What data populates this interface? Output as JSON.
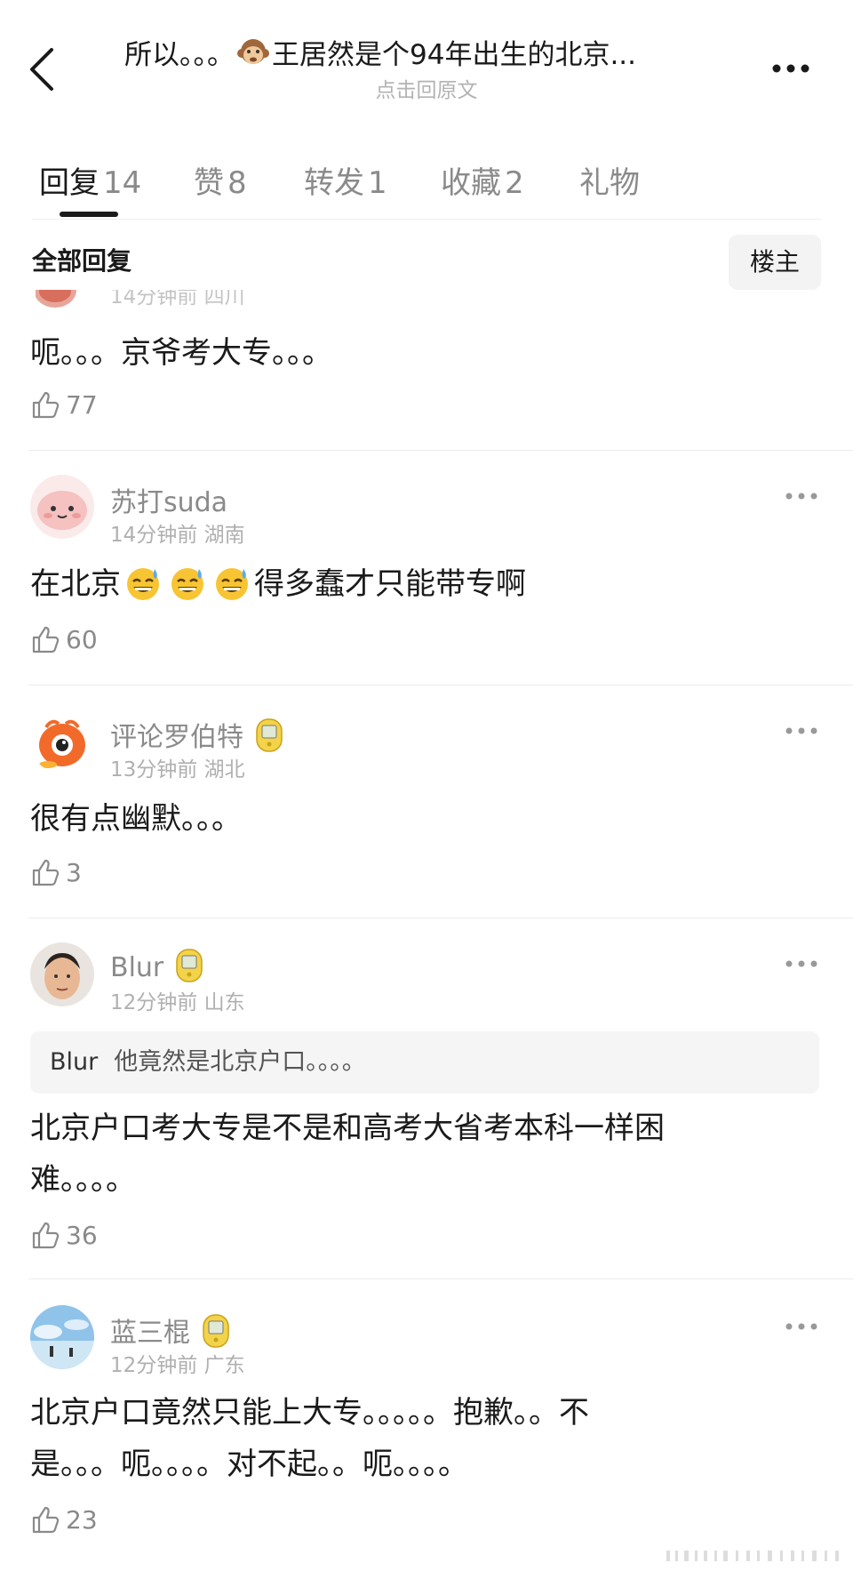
{
  "header": {
    "title_prefix": "所以。。。",
    "title_suffix": "王居然是个94年出生的北京...",
    "subtitle": "点击回原文"
  },
  "tabs": [
    {
      "label": "回复",
      "count": "14",
      "active": true
    },
    {
      "label": "赞",
      "count": "8",
      "active": false
    },
    {
      "label": "转发",
      "count": "1",
      "active": false
    },
    {
      "label": "收藏",
      "count": "2",
      "active": false
    },
    {
      "label": "礼物",
      "count": "",
      "active": false
    }
  ],
  "section": {
    "title": "全部回复",
    "owner_button": "楼主"
  },
  "partial_comment": {
    "meta": "14分钟前 四川",
    "content": "呃。。。京爷考大专。。。",
    "likes": "77"
  },
  "comments": [
    {
      "username": "苏打suda",
      "time": "14分钟前",
      "location": "湖南",
      "content_a": "在北京",
      "content_b": "得多蠢才只能带专啊",
      "likes": "60"
    },
    {
      "username": "评论罗伯特",
      "time": "13分钟前",
      "location": "湖北",
      "content": "很有点幽默。。。",
      "likes": "3"
    },
    {
      "username": "Blur",
      "time": "12分钟前",
      "location": "山东",
      "quote_name": "Blur",
      "quote_text": "他竟然是北京户口。。。。",
      "content_line1": "北京户口考大专是不是和高考大省考本科一样困",
      "content_line2": "难。。。。",
      "likes": "36"
    },
    {
      "username": "蓝三棍",
      "time": "12分钟前",
      "location": "广东",
      "content_line1": "北京户口竟然只能上大专。。。。。抱歉。。不",
      "content_line2": "是。。。呃。。。。对不起。。呃。。。。",
      "likes": "23"
    }
  ],
  "icons": [
    "back-icon",
    "more-icon",
    "like-icon",
    "monkey-emoji",
    "sweat-smile-emoji",
    "badge-icon"
  ],
  "colors": {
    "text": "#1a1a1a",
    "muted": "#8a8a8a",
    "light": "#b0b0b0",
    "quote_bg": "#f5f5f5"
  }
}
